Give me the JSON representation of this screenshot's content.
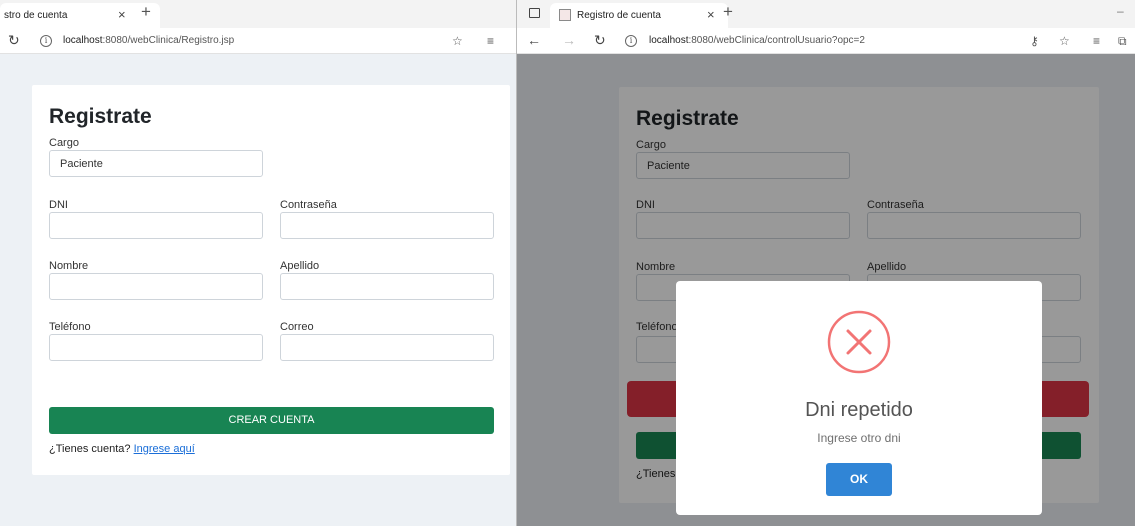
{
  "left": {
    "tab_title": "stro de cuenta",
    "tab_close": "×",
    "tab_new": "+",
    "reload_icon": "reload-icon",
    "url_host": "localhost",
    "url_rest": ":8080/webClinica/Registro.jsp",
    "form": {
      "title": "Registrate",
      "cargo_label": "Cargo",
      "cargo_value": "Paciente",
      "dni_label": "DNI",
      "password_label": "Contraseña",
      "nombre_label": "Nombre",
      "apellido_label": "Apellido",
      "telefono_label": "Teléfono",
      "correo_label": "Correo",
      "create_button": "CREAR CUENTA",
      "have_account": "¿Tienes cuenta?",
      "login_link": "Ingrese aquí"
    }
  },
  "right": {
    "tab_title": "Registro de cuenta",
    "tab_close": "×",
    "tab_new": "+",
    "url_host": "localhost",
    "url_rest": ":8080/webClinica/controlUsuario?opc=2",
    "form": {
      "title": "Registrate",
      "cargo_label": "Cargo",
      "cargo_value": "Paciente",
      "dni_label": "DNI",
      "password_label": "Contraseña",
      "nombre_label": "Nombre",
      "apellido_label": "Apellido",
      "telefono_label": "Teléfono",
      "have_account": "¿Tienes"
    },
    "dialog": {
      "title": "Dni repetido",
      "text": "Ingrese otro dni",
      "ok": "OK"
    }
  },
  "colors": {
    "create_button": "#188453",
    "page_bg": "#edf1f5",
    "error_icon": "#f27474",
    "ok_button": "#3085d6"
  }
}
